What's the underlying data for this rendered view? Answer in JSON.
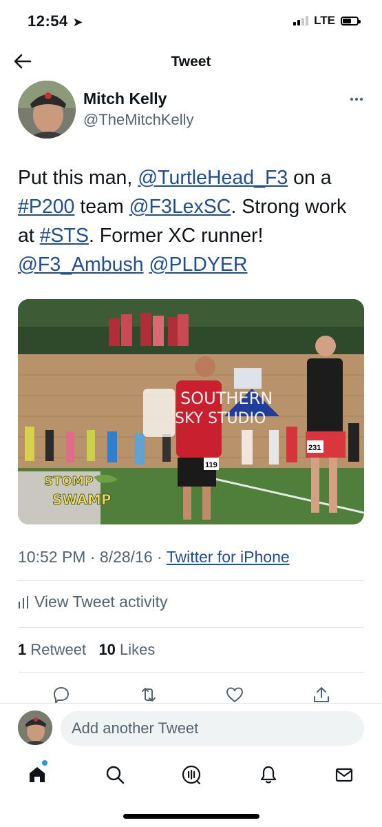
{
  "status_bar": {
    "time": "12:54",
    "network": "LTE"
  },
  "header": {
    "title": "Tweet"
  },
  "author": {
    "name": "Mitch Kelly",
    "handle": "@TheMitchKelly"
  },
  "tweet": {
    "t1": "Put this man, ",
    "m1": "@TurtleHead_F3",
    "t2": " on a ",
    "h1": "#P200",
    "t3": " team ",
    "m2": "@F3LexSC",
    "t4": ". Strong work at ",
    "h2": "#STS",
    "t5": ". Former XC runner! ",
    "m3": "@F3_Ambush",
    "t6": " ",
    "m4": "@PLDYER"
  },
  "media": {
    "banner_line1": "SOUTHERN",
    "banner_line2": "SKY STUDIO",
    "logo_line1": "STOMP",
    "logo_line2": "SWAMP",
    "bib1": "119",
    "bib2": "231"
  },
  "meta": {
    "time": "10:52 PM",
    "sep1": " · ",
    "date": "8/28/16",
    "sep2": " · ",
    "source": "Twitter for iPhone"
  },
  "activity_label": "View Tweet activity",
  "stats": {
    "retweets": "1",
    "retweets_label": "Retweet",
    "likes": "10",
    "likes_label": "Likes"
  },
  "reply": {
    "placeholder": "Add another Tweet"
  },
  "colors": {
    "link": "#1d4e9c",
    "secondary": "#536471",
    "accent": "#1d9bf0"
  }
}
